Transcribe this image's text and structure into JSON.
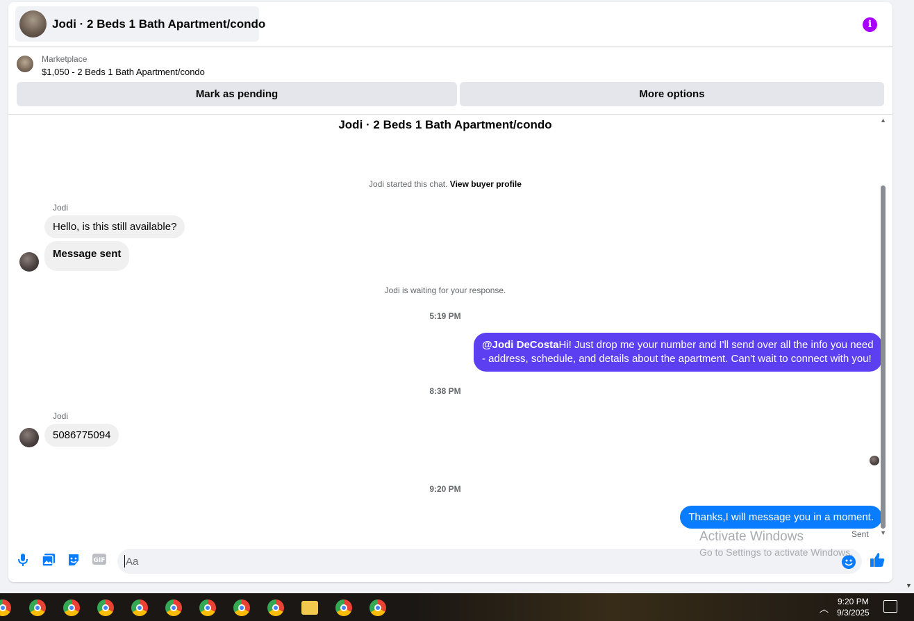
{
  "header": {
    "title": "Jodi · 2 Beds 1 Bath Apartment/condo",
    "info_icon": "info-icon"
  },
  "listing": {
    "source": "Marketplace",
    "name": "$1,050 - 2 Beds 1 Bath Apartment/condo",
    "pending_label": "Mark as pending",
    "more_label": "More options"
  },
  "thread": {
    "title": "Jodi · 2 Beds 1 Bath Apartment/condo",
    "started_text": "Jodi started this chat.",
    "view_profile": "View buyer profile",
    "waiting_text": "Jodi is waiting for your response.",
    "messages": [
      {
        "sender": "Jodi",
        "text": "Hello, is this still available?"
      },
      {
        "text": "Message sent"
      },
      {
        "timestamp": "5:19 PM"
      },
      {
        "mention": "@Jodi DeCosta",
        "text": "Hi! Just drop me your number and I'll send over all the info you need - address, schedule, and details about the apartment. Can't wait to connect with you!"
      },
      {
        "timestamp": "8:38 PM"
      },
      {
        "sender": "Jodi",
        "text": "5086775094"
      },
      {
        "timestamp": "9:20 PM"
      },
      {
        "text": "Thanks,I will message you in a moment.",
        "status": "Sent"
      }
    ]
  },
  "composer": {
    "placeholder": "Aa",
    "icons": [
      "microphone-icon",
      "photo-icon",
      "sticker-icon",
      "gif-icon",
      "emoji-icon",
      "like-icon"
    ],
    "gif_label": "GIF"
  },
  "watermark": {
    "line1": "Activate Windows",
    "line2": "Go to Settings to activate Windows."
  },
  "taskbar": {
    "time": "9:20 PM",
    "date": "9/3/2025",
    "colors": {
      "accent": "#0a7cff",
      "outgoing_bubble": "#5b3ff0"
    }
  }
}
